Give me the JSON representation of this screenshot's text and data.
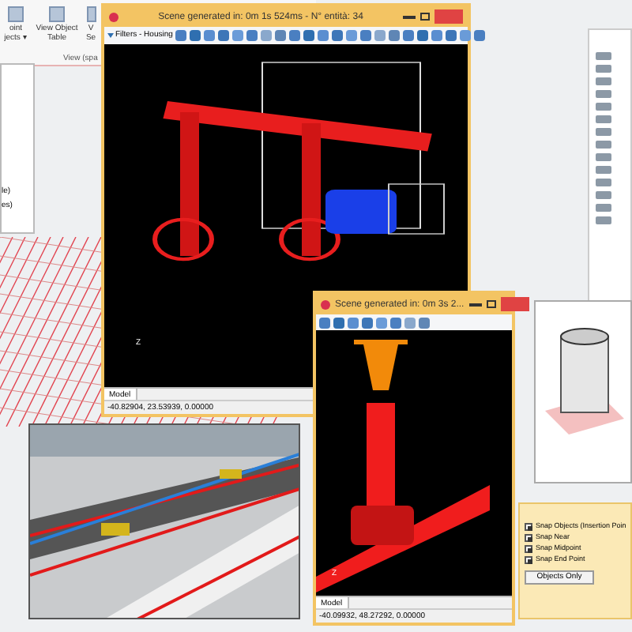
{
  "ribbon": {
    "buttons": [
      {
        "lines": [
          "oint",
          "jects ▾"
        ]
      },
      {
        "lines": [
          "View Object",
          "Table"
        ]
      },
      {
        "lines": [
          "V",
          "Se"
        ]
      }
    ],
    "group_label": "View (spa"
  },
  "left_panel": {
    "items": [
      "le)",
      "es)"
    ]
  },
  "main_window": {
    "title": "Scene generated in: 0m 1s 524ms - N° entità: 34",
    "filter_label": "Filters - Housing",
    "axis_label": "Z",
    "tab": "Model",
    "coordinates": "-40.82904, 23.53939, 0.00000"
  },
  "detail_window": {
    "title": "Scene generated in: 0m 3s 2...",
    "axis_label": "Z",
    "tab": "Model",
    "coordinates": "-40.09932, 48.27292, 0.00000"
  },
  "snap_panel": {
    "options": [
      {
        "label": "Snap Objects (Insertion Poin",
        "checked": true
      },
      {
        "label": "Snap Near",
        "checked": true
      },
      {
        "label": "Snap Midpoint",
        "checked": true
      },
      {
        "label": "Snap End Point",
        "checked": true
      }
    ],
    "button": "Objects Only"
  }
}
